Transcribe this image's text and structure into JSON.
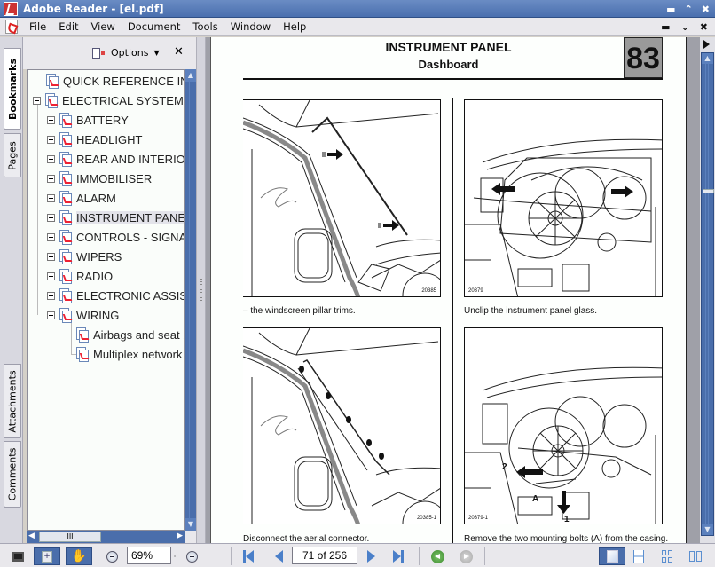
{
  "window": {
    "title": "Adobe Reader - [el.pdf]",
    "controls": [
      "minimize",
      "restore",
      "close"
    ]
  },
  "menubar": {
    "items": [
      "File",
      "Edit",
      "View",
      "Document",
      "Tools",
      "Window",
      "Help"
    ]
  },
  "side_tabs": [
    "Bookmarks",
    "Pages",
    "Attachments",
    "Comments"
  ],
  "active_side_tab": "Bookmarks",
  "bookmarks_panel": {
    "options_label": "Options",
    "items": [
      {
        "label": "QUICK REFERENCE INDEX",
        "level": 0,
        "expander": "none"
      },
      {
        "label": "ELECTRICAL SYSTEM",
        "level": 0,
        "expander": "minus"
      },
      {
        "label": "BATTERY",
        "level": 1,
        "expander": "plus"
      },
      {
        "label": "HEADLIGHT",
        "level": 1,
        "expander": "plus"
      },
      {
        "label": "REAR AND INTERIOR",
        "level": 1,
        "expander": "plus"
      },
      {
        "label": "IMMOBILISER",
        "level": 1,
        "expander": "plus"
      },
      {
        "label": "ALARM",
        "level": 1,
        "expander": "plus"
      },
      {
        "label": "INSTRUMENT PANEL",
        "level": 1,
        "expander": "plus",
        "selected": true
      },
      {
        "label": "CONTROLS - SIGNALS",
        "level": 1,
        "expander": "plus"
      },
      {
        "label": "WIPERS",
        "level": 1,
        "expander": "plus"
      },
      {
        "label": "RADIO",
        "level": 1,
        "expander": "plus"
      },
      {
        "label": "ELECTRONIC ASSISTANCE",
        "level": 1,
        "expander": "plus"
      },
      {
        "label": "WIRING",
        "level": 1,
        "expander": "minus"
      },
      {
        "label": "Airbags and seat belts",
        "level": 2,
        "expander": "none"
      },
      {
        "label": "Multiplex network",
        "level": 2,
        "expander": "none"
      }
    ]
  },
  "document": {
    "heading": "INSTRUMENT PANEL",
    "subheading": "Dashboard",
    "page_number_box": "83",
    "figures": [
      {
        "ref": "20385",
        "caption": "– the windscreen pillar trims."
      },
      {
        "ref": "20379",
        "caption": "Unclip the instrument panel glass."
      },
      {
        "ref": "20385-1",
        "caption": "Disconnect the aerial connector."
      },
      {
        "ref": "20379-1",
        "caption": "Remove the two mounting bolts (A) from the casing.",
        "labels": [
          "2",
          "A",
          "1"
        ]
      }
    ]
  },
  "statusbar": {
    "zoom": "69%",
    "page_indicator": "71 of 256",
    "current_page": 71,
    "total_pages": 256
  },
  "colors": {
    "titlebar": "#4a6fae",
    "scrollbar": "#4a6eab",
    "nav_blue": "#4a7fc9",
    "back_green": "#3d8a2e"
  }
}
